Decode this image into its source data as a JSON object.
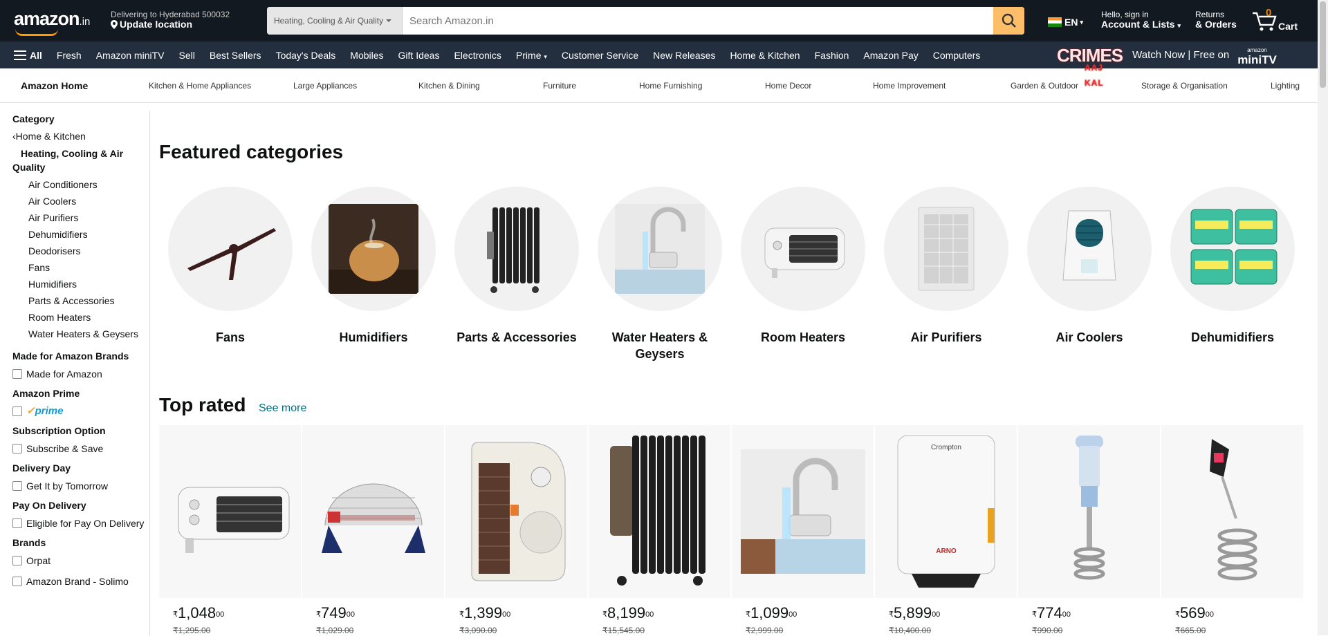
{
  "header": {
    "logo": "amazon",
    "logo_tld": ".in",
    "deliver_line1": "Delivering to Hyderabad 500032",
    "deliver_line2": "Update location",
    "search_category": "Heating, Cooling & Air Quality",
    "search_placeholder": "Search Amazon.in",
    "lang": "EN",
    "account_line1": "Hello, sign in",
    "account_line2": "Account & Lists",
    "returns_line1": "Returns",
    "returns_line2": "& Orders",
    "cart_count": "0",
    "cart_label": "Cart"
  },
  "nav": {
    "all": "All",
    "items": [
      "Fresh",
      "Amazon miniTV",
      "Sell",
      "Best Sellers",
      "Today's Deals",
      "Mobiles",
      "Gift Ideas",
      "Electronics",
      "Prime",
      "Customer Service",
      "New Releases",
      "Home & Kitchen",
      "Fashion",
      "Amazon Pay",
      "Computers"
    ],
    "promo_brand": "CRIMES",
    "promo_sub": "AAJ KAL",
    "promo_text": "Watch Now | Free on",
    "promo_mtv_top": "amazon",
    "promo_mtv": "miniTV"
  },
  "subnav": {
    "home": "Amazon Home",
    "items": [
      "Kitchen & Home Appliances",
      "Large Appliances",
      "Kitchen & Dining",
      "Furniture",
      "Home Furnishing",
      "Home Decor",
      "Home Improvement",
      "Garden & Outdoor",
      "Storage & Organisation",
      "Lighting"
    ]
  },
  "sidebar": {
    "category_title": "Category",
    "parent": "Home & Kitchen",
    "current": "Heating, Cooling & Air Quality",
    "subcats": [
      "Air Conditioners",
      "Air Coolers",
      "Air Purifiers",
      "Dehumidifiers",
      "Deodorisers",
      "Fans",
      "Humidifiers",
      "Parts & Accessories",
      "Room Heaters",
      "Water Heaters & Geysers"
    ],
    "made_for_title": "Made for Amazon Brands",
    "made_for_option": "Made for Amazon",
    "prime_title": "Amazon Prime",
    "prime_option": "prime",
    "subscription_title": "Subscription Option",
    "subscription_option": "Subscribe & Save",
    "delivery_title": "Delivery Day",
    "delivery_option": "Get It by Tomorrow",
    "pod_title": "Pay On Delivery",
    "pod_option": "Eligible for Pay On Delivery",
    "brands_title": "Brands",
    "brands": [
      "Orpat",
      "Amazon Brand - Solimo"
    ]
  },
  "featured": {
    "title": "Featured categories",
    "items": [
      {
        "label": "Fans",
        "icon": "ceiling-fan"
      },
      {
        "label": "Humidifiers",
        "icon": "wood-humidifier"
      },
      {
        "label": "Parts & Accessories",
        "icon": "oil-heater"
      },
      {
        "label": "Water Heaters & Geysers",
        "icon": "instant-water-heater-tap"
      },
      {
        "label": "Room Heaters",
        "icon": "fan-heater"
      },
      {
        "label": "Air Purifiers",
        "icon": "air-purifier"
      },
      {
        "label": "Air Coolers",
        "icon": "air-cooler"
      },
      {
        "label": "Dehumidifiers",
        "icon": "absorbia-tubs"
      }
    ]
  },
  "top_rated": {
    "title": "Top rated",
    "see_more": "See more",
    "currency": "₹",
    "products": [
      {
        "price": "1,048",
        "paise": "00",
        "mrp": "₹1,295.00",
        "icon": "fan-heater"
      },
      {
        "price": "749",
        "paise": "00",
        "mrp": "₹1,029.00",
        "icon": "halogen-heater"
      },
      {
        "price": "1,399",
        "paise": "00",
        "mrp": "₹3,090.00",
        "icon": "orient-heater"
      },
      {
        "price": "8,199",
        "paise": "00",
        "mrp": "₹15,545.00",
        "icon": "oil-radiator"
      },
      {
        "price": "1,099",
        "paise": "00",
        "mrp": "₹2,999.00",
        "icon": "water-heater-tap"
      },
      {
        "price": "5,899",
        "paise": "00",
        "mrp": "₹10,400.00",
        "icon": "crompton-geyser",
        "brand": "Crompton",
        "model": "ARNO"
      },
      {
        "price": "774",
        "paise": "00",
        "mrp": "₹990.00",
        "icon": "immersion-rod"
      },
      {
        "price": "569",
        "paise": "00",
        "mrp": "₹665.00",
        "icon": "coil-immersion-rod"
      }
    ]
  }
}
